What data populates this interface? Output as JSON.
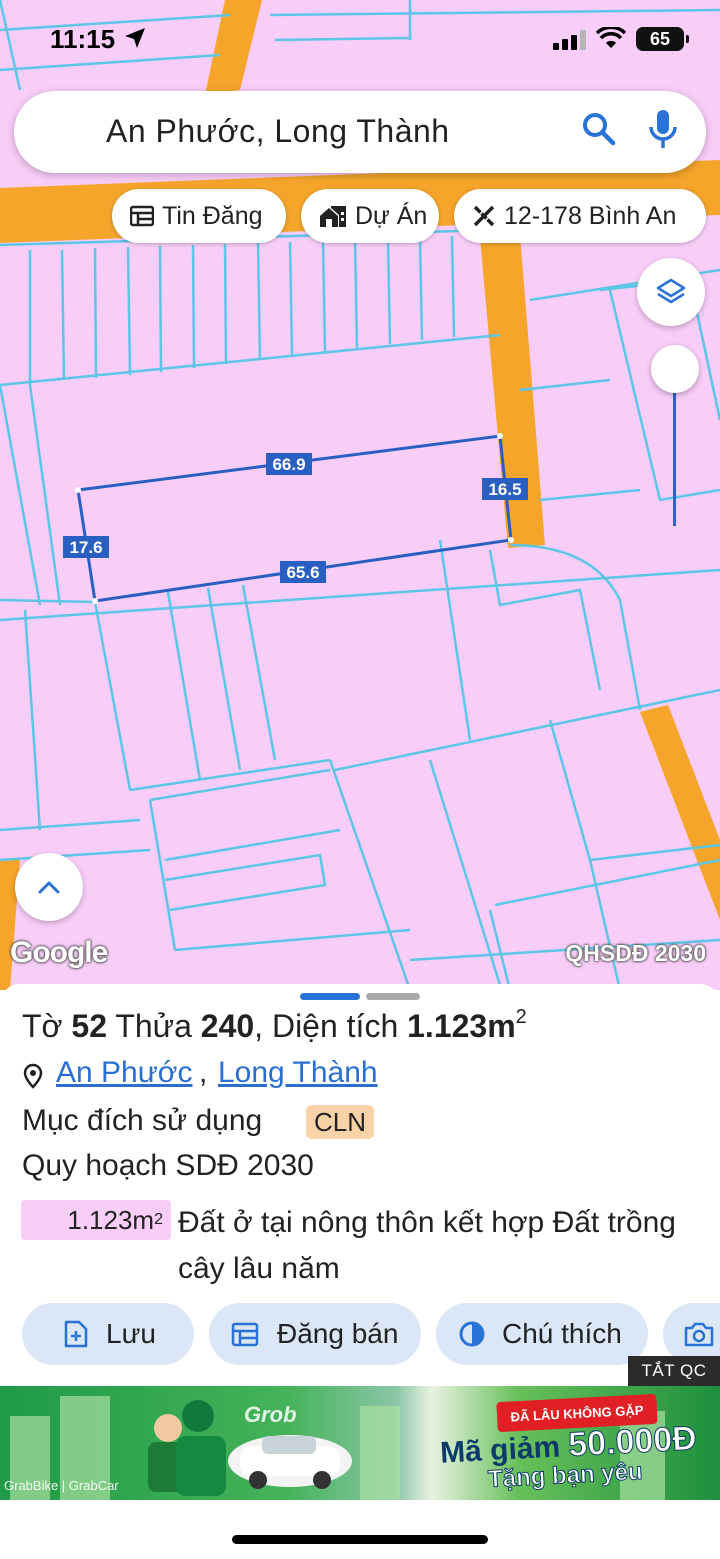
{
  "status_bar": {
    "time": "11:15",
    "battery": "65"
  },
  "search": {
    "query": "An Phước, Long Thành"
  },
  "chips": [
    {
      "label": "Tin Đăng",
      "icon": "listing-icon"
    },
    {
      "label": "Dự Án",
      "icon": "project-icon"
    },
    {
      "label": "12-178 Bình An",
      "icon": "ruler-icon"
    }
  ],
  "map": {
    "attribution": "Google",
    "layer_label": "QHSDĐ 2030",
    "measurements": {
      "top": "66.9",
      "right": "16.5",
      "bottom": "65.6",
      "left": "17.6"
    },
    "colors": {
      "land": "#f8cdf8",
      "road": "#f5a52a",
      "parcel_line": "#5bc6e6",
      "selection": "#2a5fc2"
    }
  },
  "parcel": {
    "to_label": "Tờ",
    "to_value": "52",
    "thua_label": "Thửa",
    "thua_value": "240",
    "area_label": "Diện tích",
    "area_value": "1.123m",
    "area_unit_sup": "2",
    "ward_link": "An Phước",
    "district_link": "Long Thành",
    "purpose_label": "Mục đích sử dụng",
    "purpose_code": "CLN",
    "plan_label": "Quy hoạch SDĐ 2030",
    "plan_area": "1.123m",
    "plan_area_sup": "2",
    "plan_desc": "Đất ở tại nông thôn kết hợp Đất trồng cây lâu năm"
  },
  "actions": [
    {
      "label": "Lưu",
      "icon": "save-icon"
    },
    {
      "label": "Đăng bán",
      "icon": "calendar-icon"
    },
    {
      "label": "Chú thích",
      "icon": "contrast-icon"
    },
    {
      "label": "",
      "icon": "camera-icon"
    }
  ],
  "ad": {
    "close_label": "TẮT QC",
    "brand": "Grob",
    "badge": "ĐÃ LÂU KHÔNG GẶP",
    "line1_prefix": "Mã giảm",
    "line1_amount": "50.000Đ",
    "line2": "Tặng bạn yêu",
    "footer": "GrabBike | GrabCar"
  }
}
